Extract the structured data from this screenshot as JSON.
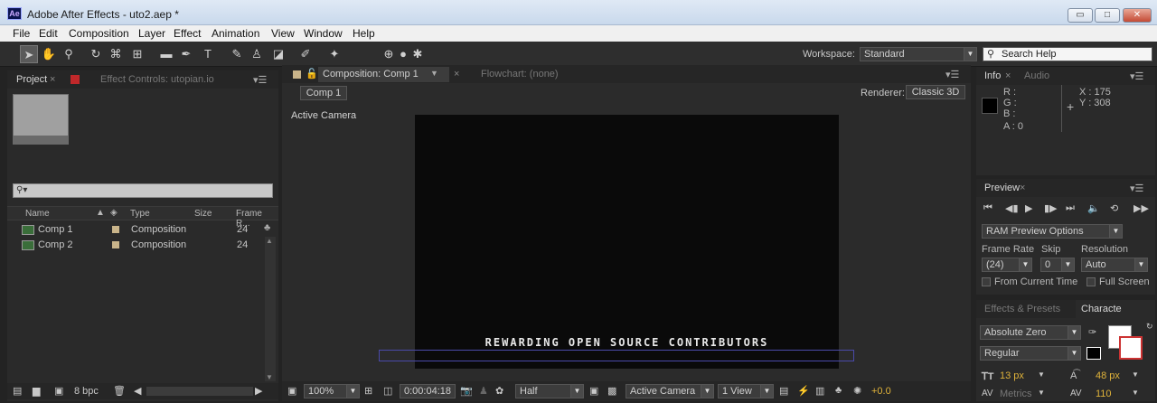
{
  "window": {
    "title": "Adobe After Effects - uto2.aep *",
    "app_icon": "Ae",
    "minimize": "▭",
    "maximize": "□",
    "close": "✕"
  },
  "menu": [
    "File",
    "Edit",
    "Composition",
    "Layer",
    "Effect",
    "Animation",
    "View",
    "Window",
    "Help"
  ],
  "toolbar": {
    "workspace_label": "Workspace:",
    "workspace_value": "Standard",
    "search_placeholder": "Search Help"
  },
  "project": {
    "tab": "Project",
    "effect_controls_tab": "Effect Controls: utopian.io",
    "columns": {
      "name": "Name",
      "type": "Type",
      "size": "Size",
      "frame_rate": "Frame R..."
    },
    "items": [
      {
        "name": "Comp 1",
        "type": "Composition",
        "frame_rate": "24"
      },
      {
        "name": "Comp 2",
        "type": "Composition",
        "frame_rate": "24"
      }
    ],
    "bpc": "8 bpc"
  },
  "composition": {
    "tab": "Composition: Comp 1",
    "flowchart_tab": "Flowchart: (none)",
    "breadcrumb": "Comp 1",
    "renderer_label": "Renderer:",
    "renderer_value": "Classic 3D",
    "view_label": "Active Camera",
    "overlay_text": "REWARDING OPEN SOURCE CONTRIBUTORS",
    "footer": {
      "zoom": "100%",
      "timecode": "0:00:04:18",
      "resolution": "Half",
      "camera": "Active Camera",
      "views": "1 View",
      "exposure": "+0.0"
    }
  },
  "info": {
    "tab": "Info",
    "audio_tab": "Audio",
    "r": "R :",
    "g": "G :",
    "b": "B :",
    "a": "A : 0",
    "x": "X : 175",
    "y": "Y : 308"
  },
  "preview": {
    "tab": "Preview",
    "ram_options": "RAM Preview Options",
    "frame_rate_label": "Frame Rate",
    "skip_label": "Skip",
    "resolution_label": "Resolution",
    "frame_rate_value": "(24)",
    "skip_value": "0",
    "resolution_value": "Auto",
    "from_current": "From Current Time",
    "full_screen": "Full Screen"
  },
  "character": {
    "effects_tab": "Effects & Presets",
    "character_tab": "Characte",
    "font": "Absolute Zero",
    "style": "Regular",
    "size": "13 px",
    "leading": "48 px",
    "kerning": "Metrics",
    "tracking": "110"
  }
}
